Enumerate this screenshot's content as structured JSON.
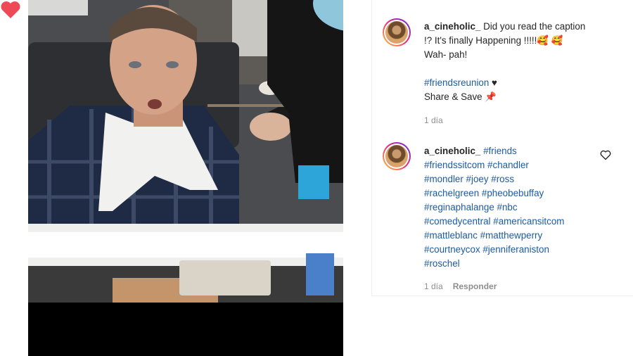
{
  "post": {
    "photo_alt": "Man in makeup chair having makeup applied"
  },
  "actions": {
    "like_icon": "heart-filled-icon",
    "comment_icon": "comment-icon",
    "share_icon": "share-icon",
    "save_icon": "bookmark-icon",
    "like_color": "#ed4956"
  },
  "comments": [
    {
      "username": "a_cineholic_",
      "line1": " Did you read the caption",
      "line2": "!? It's finally Happening !!!!!🥰 🥰",
      "line3": "Wah- pah!",
      "hashtag": "#friendsreunion",
      "heart": " ♥",
      "line5": "Share & Save 📌",
      "time": "1 día"
    },
    {
      "username": "a_cineholic_",
      "tags_line1": " #friends",
      "tags_rest": [
        "#friendssitcom #chandler",
        "#mondler #joey #ross",
        "#rachelgreen #pheobebuffay",
        "#reginaphalange #nbc",
        "#comedycentral #americansitcom",
        "#mattleblanc #matthewperry",
        "#courtneycox #jenniferaniston",
        "#roschel"
      ],
      "time": "1 día",
      "reply": "Responder"
    }
  ]
}
